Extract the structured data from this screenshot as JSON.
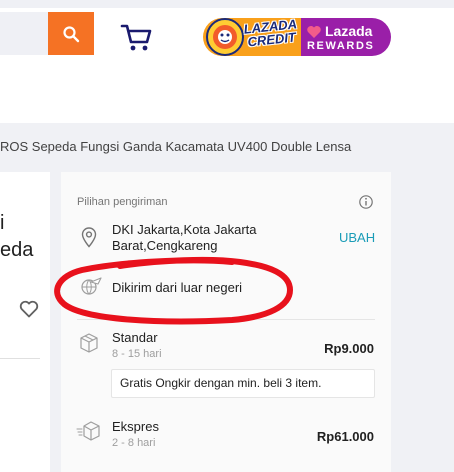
{
  "header": {
    "search_placeholder": "",
    "search_icon": "search-icon",
    "cart_icon": "cart-icon",
    "brand_color": "#f57224",
    "promo": {
      "credit_text_l1": "LAZADA",
      "credit_text_l2": "CREDIT",
      "rewards_text_l1": "Lazada",
      "rewards_text_l2": "REWARDS",
      "credit_color": "#f9a01b",
      "rewards_color": "#9a1fa8"
    }
  },
  "breadcrumb": {
    "text": "ROS Sepeda Fungsi Ganda Kacamata UV400 Double Lensa"
  },
  "product": {
    "title_fragment_l1": "i",
    "title_fragment_l2": "eda",
    "wishlist_icon": "heart-outline-icon"
  },
  "delivery": {
    "section_title": "Pilihan pengiriman",
    "info_icon": "info-icon",
    "location": {
      "icon": "location-pin-icon",
      "text": "DKI Jakarta,Kota Jakarta Barat,Cengkareng",
      "change_label": "UBAH",
      "change_color": "#1a9cb7"
    },
    "origin": {
      "icon": "plane-globe-icon",
      "text": "Dikirim dari luar negeri"
    },
    "options": [
      {
        "icon": "package-standard-icon",
        "name": "Standar",
        "time": "8 - 15 hari",
        "price": "Rp9.000",
        "note": "Gratis Ongkir dengan min. beli 3 item."
      },
      {
        "icon": "package-express-icon",
        "name": "Ekspres",
        "time": "2 - 8 hari",
        "price": "Rp61.000"
      }
    ]
  },
  "annotation": {
    "color": "#e8111c",
    "shape": "hand-drawn-ellipse"
  }
}
